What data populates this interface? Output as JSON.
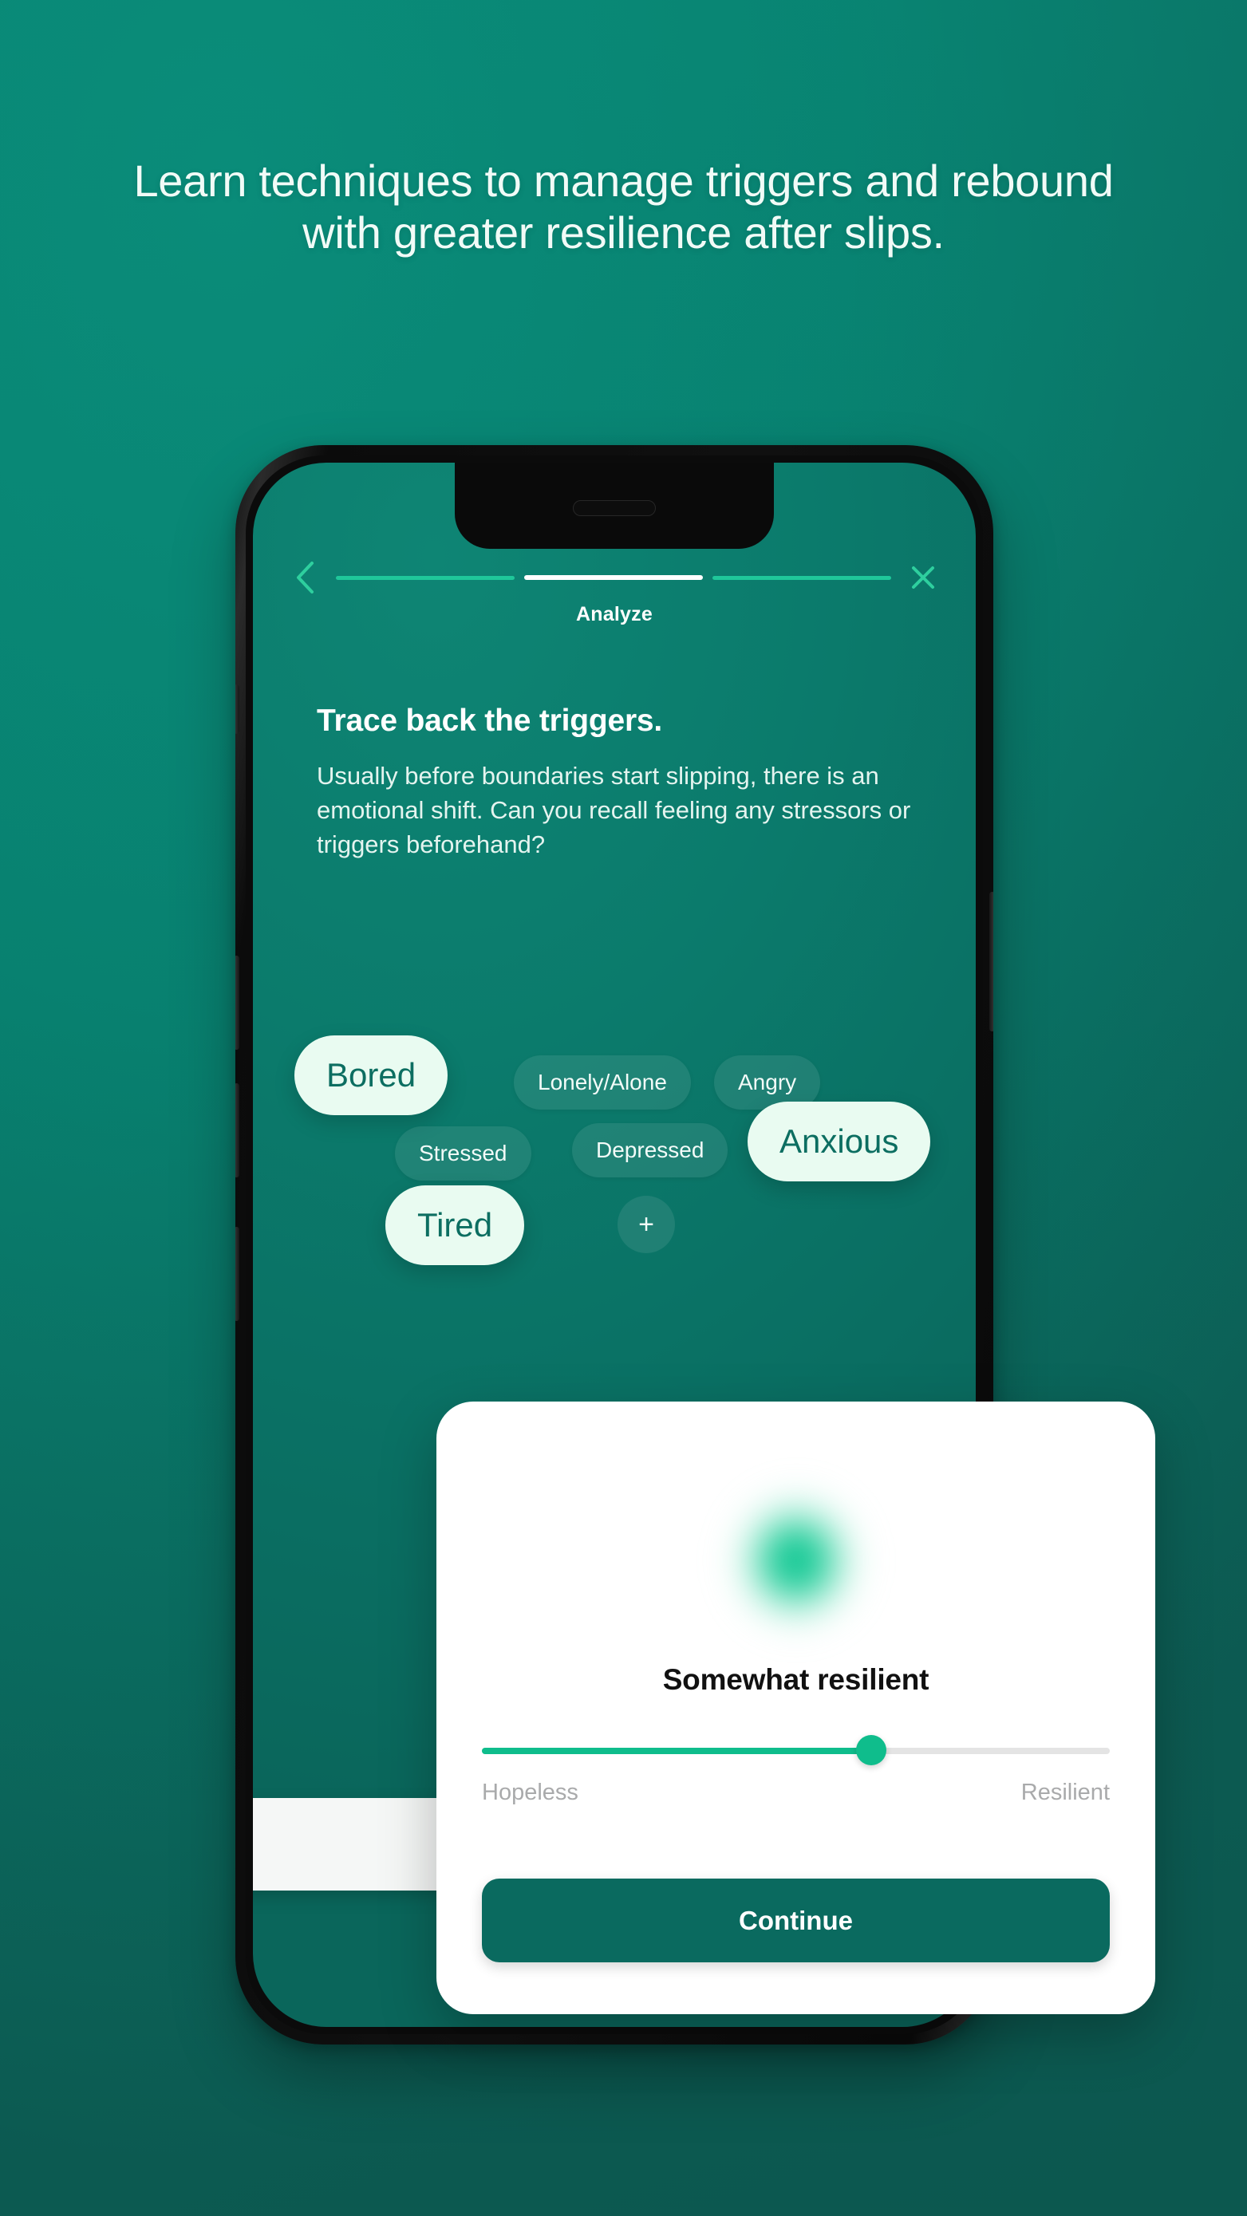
{
  "background": {
    "top_color": "#088071",
    "bottom_color": "#0e5f56"
  },
  "headline": "Learn techniques to manage triggers and rebound with greater resilience after slips.",
  "phone": {
    "header": {
      "back_icon": "chevron-left-icon",
      "close_icon": "close-x-icon",
      "progress": {
        "total_steps": 3,
        "active_step": 2
      },
      "step_title": "Analyze"
    },
    "question": {
      "title": "Trace back the triggers.",
      "body": "Usually before boundaries start slipping, there is an emotional shift. Can you recall feeling any stressors or triggers beforehand?"
    },
    "chips": [
      {
        "label": "Bored",
        "selected": true
      },
      {
        "label": "Lonely/Alone",
        "selected": false
      },
      {
        "label": "Angry",
        "selected": false
      },
      {
        "label": "Stressed",
        "selected": false
      },
      {
        "label": "Depressed",
        "selected": false
      },
      {
        "label": "Anxious",
        "selected": true
      },
      {
        "label": "Tired",
        "selected": true
      }
    ],
    "add_chip_label": "+"
  },
  "card": {
    "orb_color": "#03c08c",
    "title": "Somewhat resilient",
    "slider": {
      "value_percent": 62,
      "left_label": "Hopeless",
      "right_label": "Resilient",
      "fill_color": "#0fbd8c",
      "track_color": "#e4e4e4"
    },
    "continue_label": "Continue",
    "continue_color": "#0a6a5f"
  }
}
